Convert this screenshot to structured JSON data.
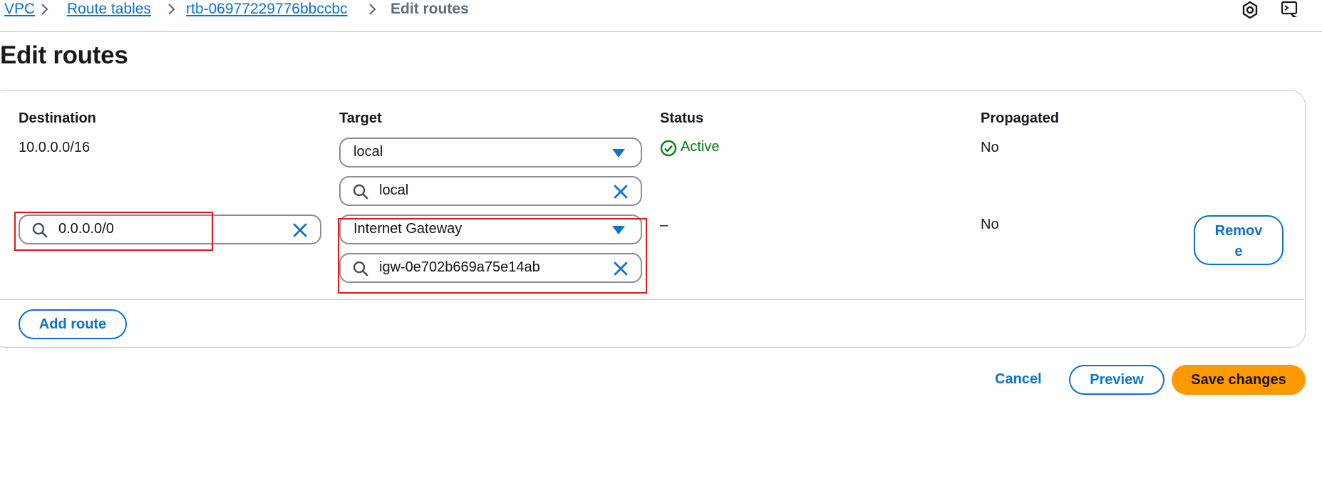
{
  "breadcrumb": {
    "items": [
      "VPC",
      "Route tables",
      "rtb-06977229776bbccbc"
    ],
    "current": "Edit routes"
  },
  "header_icons": [
    "hexagon-settings-icon",
    "cloudshell-icon"
  ],
  "page_title": "Edit routes",
  "table": {
    "columns": [
      "Destination",
      "Target",
      "Status",
      "Propagated"
    ],
    "rows": [
      {
        "destination": "10.0.0.0/16",
        "target_type": "local",
        "target_value": "local",
        "status": "Active",
        "propagated": "No"
      },
      {
        "destination": "0.0.0.0/0",
        "target_type": "Internet Gateway",
        "target_value": "igw-0e702b669a75e14ab",
        "status": "–",
        "propagated": "No",
        "remove_label_line1": "Remov",
        "remove_label_line2": "e"
      }
    ]
  },
  "add_route_label": "Add route",
  "footer": {
    "cancel_label": "Cancel",
    "preview_label": "Preview",
    "save_label": "Save changes"
  },
  "colors": {
    "link": "#0972d3",
    "primary_button": "#ff9900",
    "status_active": "#037f0c",
    "highlight": "#e0181b"
  }
}
